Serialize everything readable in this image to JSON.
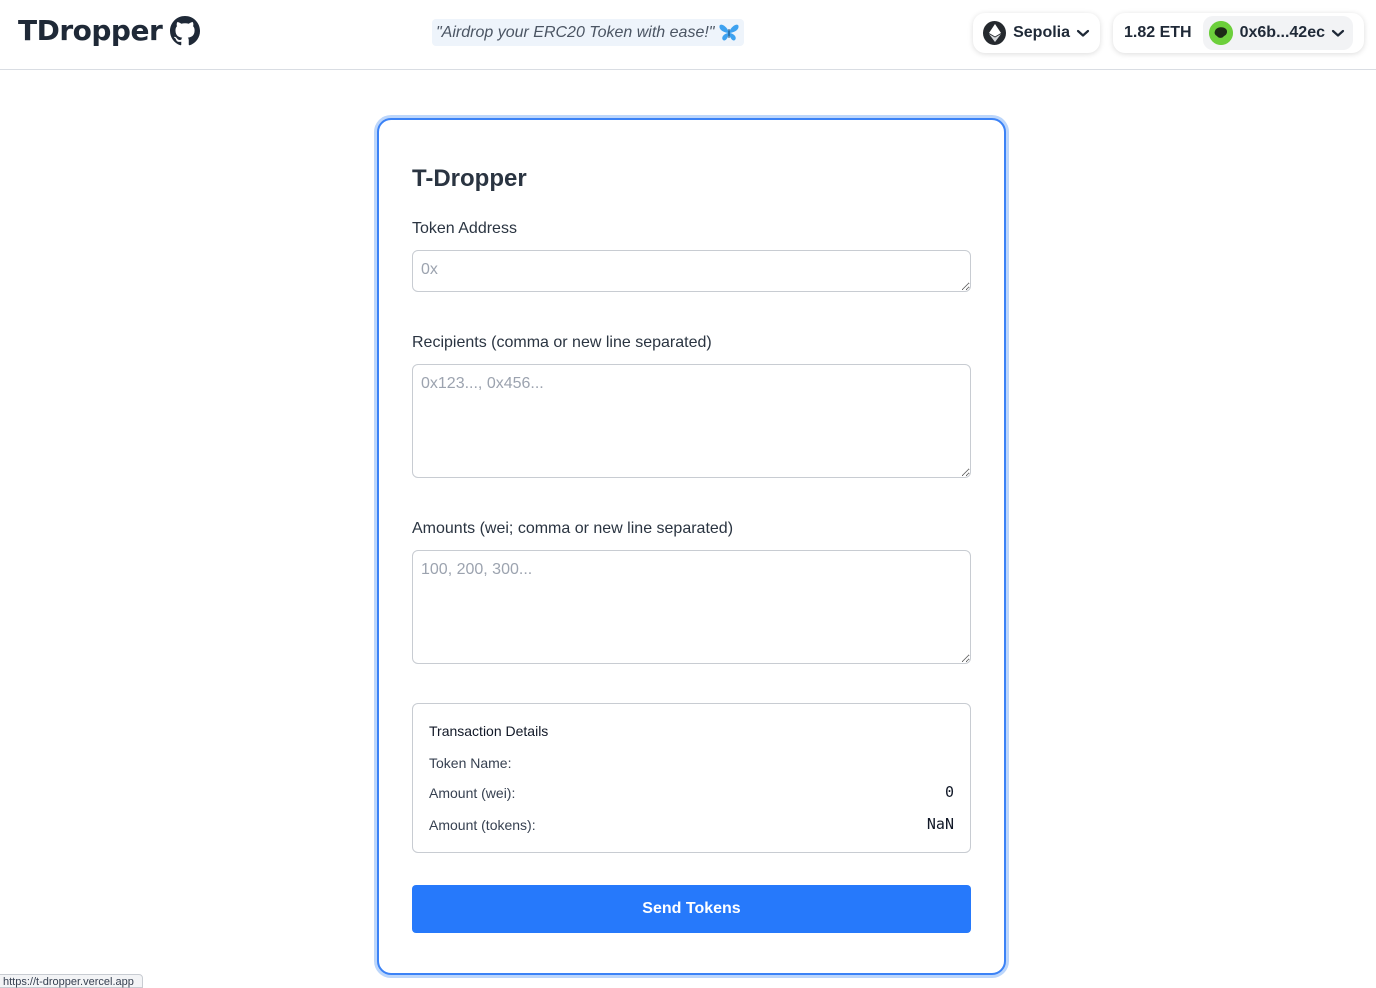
{
  "header": {
    "brand": "TDropper",
    "tagline": "\"Airdrop your ERC20 Token with ease!\"",
    "network": "Sepolia",
    "balance": "1.82 ETH",
    "account": "0x6b...42ec"
  },
  "form": {
    "title": "T-Dropper",
    "token_address": {
      "label": "Token Address",
      "placeholder": "0x",
      "value": ""
    },
    "recipients": {
      "label": "Recipients (comma or new line separated)",
      "placeholder": "0x123..., 0x456...",
      "value": ""
    },
    "amounts": {
      "label": "Amounts (wei; comma or new line separated)",
      "placeholder": "100, 200, 300...",
      "value": ""
    },
    "details": {
      "title": "Transaction Details",
      "token_name_label": "Token Name:",
      "token_name_value": "",
      "amount_wei_label": "Amount (wei):",
      "amount_wei_value": "0",
      "amount_tokens_label": "Amount (tokens):",
      "amount_tokens_value": "NaN"
    },
    "send_label": "Send Tokens"
  },
  "status_bar": {
    "url": "https://t-dropper.vercel.app"
  },
  "colors": {
    "accent": "#2679fb",
    "card_border": "#3b82f6",
    "avatar": "#6ccf3b"
  },
  "icons": {
    "brand": "github-icon",
    "tagline": "butterfly-icon",
    "network": "ethereum-icon",
    "dropdown": "chevron-down-icon",
    "account": "avatar-icon"
  }
}
